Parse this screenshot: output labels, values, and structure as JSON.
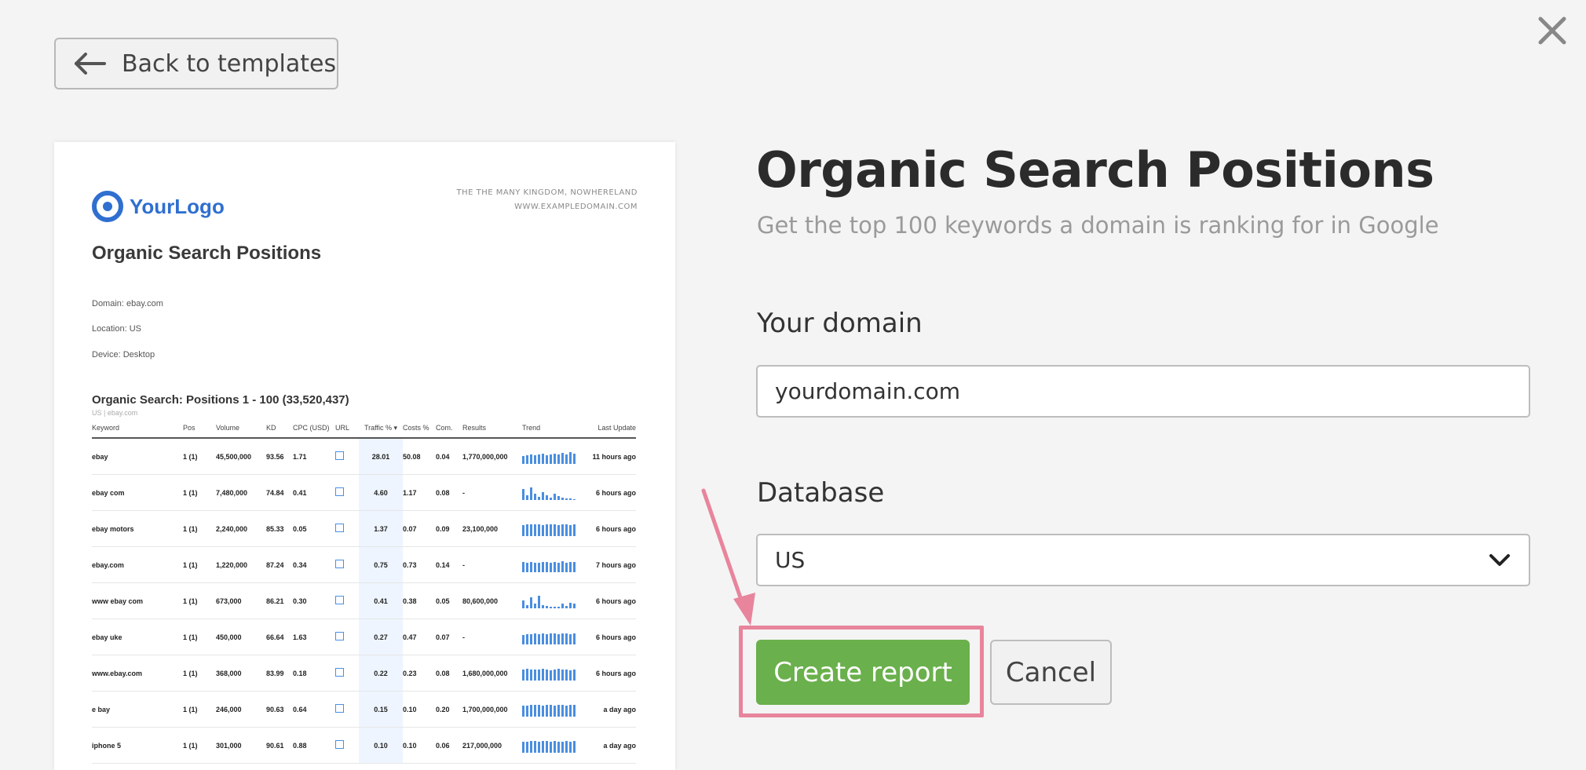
{
  "header": {
    "back_label": "Back to templates"
  },
  "preview": {
    "logo_text": "YourLogo",
    "address_line1": "THE THE MANY KINGDOM, NOWHERELAND",
    "address_line2": "WWW.EXAMPLEDOMAIN.COM",
    "title": "Organic Search Positions",
    "domain_line": "Domain: ebay.com",
    "location_line": "Location: US",
    "device_line": "Device: Desktop",
    "table_title": "Organic Search: Positions 1 - 100 (33,520,437)",
    "table_subtitle": "US | ebay.com",
    "columns": [
      "Keyword",
      "Pos",
      "Volume",
      "KD",
      "CPC (USD)",
      "URL",
      "Traffic % ▾",
      "Costs %",
      "Com.",
      "Results",
      "Trend",
      "Last Update"
    ],
    "rows": [
      {
        "keyword": "ebay",
        "pos": "1 (1)",
        "volume": "45,500,000",
        "kd": "93.56",
        "cpc": "1.71",
        "traffic": "28.01",
        "costs": "50.08",
        "com": "0.04",
        "results": "1,770,000,000",
        "updated": "11 hours ago"
      },
      {
        "keyword": "ebay com",
        "pos": "1 (1)",
        "volume": "7,480,000",
        "kd": "74.84",
        "cpc": "0.41",
        "traffic": "4.60",
        "costs": "1.17",
        "com": "0.08",
        "results": "-",
        "updated": "6 hours ago"
      },
      {
        "keyword": "ebay motors",
        "pos": "1 (1)",
        "volume": "2,240,000",
        "kd": "85.33",
        "cpc": "0.05",
        "traffic": "1.37",
        "costs": "0.07",
        "com": "0.09",
        "results": "23,100,000",
        "updated": "6 hours ago"
      },
      {
        "keyword": "ebay.com",
        "pos": "1 (1)",
        "volume": "1,220,000",
        "kd": "87.24",
        "cpc": "0.34",
        "traffic": "0.75",
        "costs": "0.73",
        "com": "0.14",
        "results": "-",
        "updated": "7 hours ago"
      },
      {
        "keyword": "www ebay com",
        "pos": "1 (1)",
        "volume": "673,000",
        "kd": "86.21",
        "cpc": "0.30",
        "traffic": "0.41",
        "costs": "0.38",
        "com": "0.05",
        "results": "80,600,000",
        "updated": "6 hours ago"
      },
      {
        "keyword": "ebay uke",
        "pos": "1 (1)",
        "volume": "450,000",
        "kd": "66.64",
        "cpc": "1.63",
        "traffic": "0.27",
        "costs": "0.47",
        "com": "0.07",
        "results": "-",
        "updated": "6 hours ago"
      },
      {
        "keyword": "www.ebay.com",
        "pos": "1 (1)",
        "volume": "368,000",
        "kd": "83.99",
        "cpc": "0.18",
        "traffic": "0.22",
        "costs": "0.23",
        "com": "0.08",
        "results": "1,680,000,000",
        "updated": "6 hours ago"
      },
      {
        "keyword": "e bay",
        "pos": "1 (1)",
        "volume": "246,000",
        "kd": "90.63",
        "cpc": "0.64",
        "traffic": "0.15",
        "costs": "0.10",
        "com": "0.20",
        "results": "1,700,000,000",
        "updated": "a day ago"
      },
      {
        "keyword": "iphone 5",
        "pos": "1 (1)",
        "volume": "301,000",
        "kd": "90.61",
        "cpc": "0.88",
        "traffic": "0.10",
        "costs": "0.10",
        "com": "0.06",
        "results": "217,000,000",
        "updated": "a day ago"
      }
    ]
  },
  "form": {
    "title": "Organic Search Positions",
    "subtitle": "Get the top 100 keywords a domain is ranking for in Google",
    "domain_label": "Your domain",
    "domain_value": "yourdomain.com",
    "database_label": "Database",
    "database_value": "US",
    "create_label": "Create report",
    "cancel_label": "Cancel"
  },
  "colors": {
    "primary_button": "#6ab04c",
    "highlight": "#e8849c",
    "logo_blue": "#2f6fd0"
  },
  "icons": {
    "close": "close-icon",
    "back": "arrow-left-icon",
    "select": "chevron-down-icon",
    "logo": "logo-icon",
    "annotation": "annotation-arrow-icon"
  }
}
